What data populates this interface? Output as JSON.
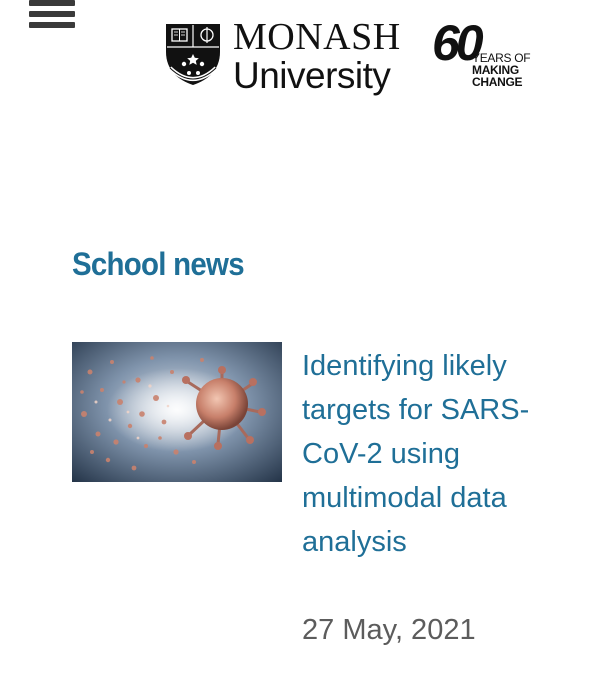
{
  "header": {
    "menu_icon": "hamburger-menu-icon",
    "logo": {
      "line1": "MONASH",
      "line2": "University",
      "crest_icon": "monash-crest-icon"
    },
    "anniversary": {
      "number": "60",
      "line1": "YEARS OF",
      "line2": "MAKING",
      "line3": "CHANGE"
    }
  },
  "section": {
    "title": "School news"
  },
  "news": [
    {
      "image_icon": "coronavirus-image",
      "headline": "Identifying likely targets for SARS-CoV-2 using multimodal data analysis",
      "date": "27 May, 2021"
    }
  ],
  "colors": {
    "accent": "#1f6f97",
    "date": "#5c5c5c",
    "text": "#111111"
  }
}
